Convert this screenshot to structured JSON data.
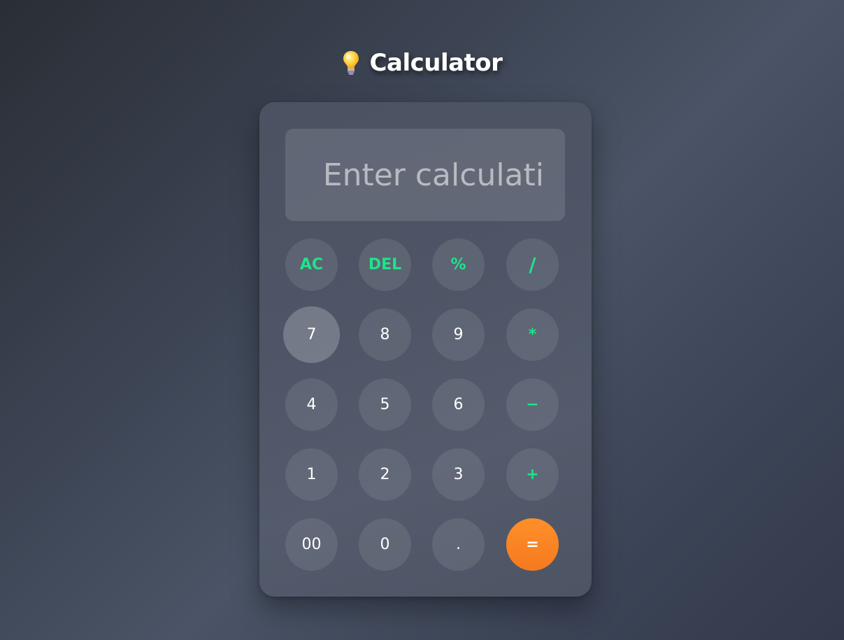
{
  "header": {
    "icon": "lightbulb-icon",
    "title": "Calculator"
  },
  "display": {
    "value": "",
    "placeholder": "Enter calculati"
  },
  "buttons": {
    "ac": "AC",
    "del": "DEL",
    "percent": "%",
    "divide": "/",
    "seven": "7",
    "eight": "8",
    "nine": "9",
    "multiply": "*",
    "four": "4",
    "five": "5",
    "six": "6",
    "minus": "−",
    "one": "1",
    "two": "2",
    "three": "3",
    "plus": "+",
    "double_zero": "00",
    "zero": "0",
    "decimal": ".",
    "equals": "="
  },
  "colors": {
    "operator": "#1ee38a",
    "equals": "#f7841f",
    "text": "#ffffff"
  }
}
